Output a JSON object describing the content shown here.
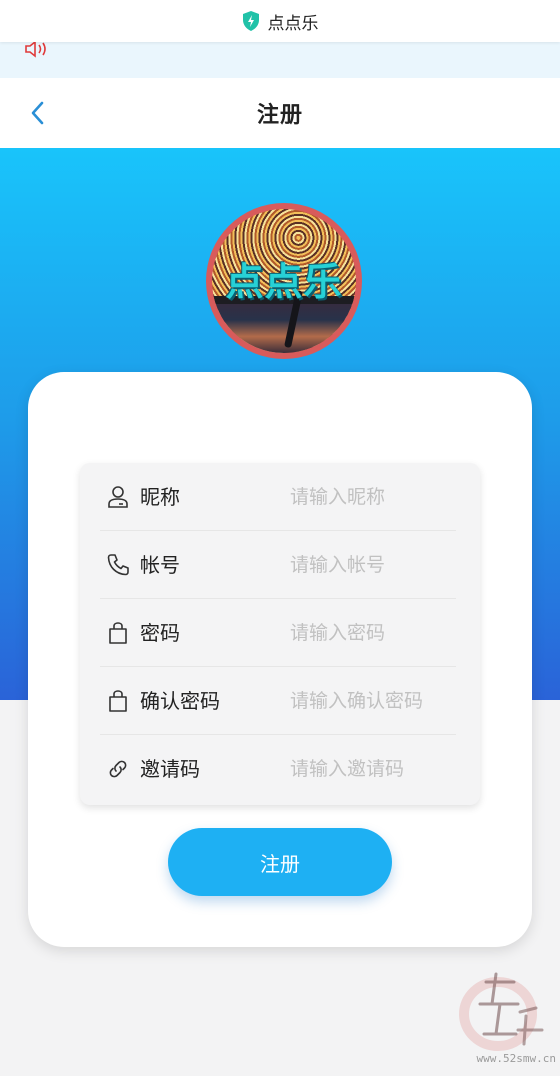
{
  "topbar": {
    "title": "点点乐",
    "icon": "shield-bolt-icon",
    "accent": "#21c2a8"
  },
  "notice": {
    "icon": "speaker-icon",
    "color": "#e03b3b"
  },
  "header": {
    "title": "注册",
    "back_icon": "chevron-left-icon"
  },
  "logo": {
    "text": "点点乐"
  },
  "form": {
    "fields": [
      {
        "label": "昵称",
        "placeholder": "请输入昵称",
        "value": "",
        "icon": "user-icon"
      },
      {
        "label": "帐号",
        "placeholder": "请输入帐号",
        "value": "",
        "icon": "phone-icon"
      },
      {
        "label": "密码",
        "placeholder": "请输入密码",
        "value": "",
        "icon": "bag-icon"
      },
      {
        "label": "确认密码",
        "placeholder": "请输入确认密码",
        "value": "",
        "icon": "bag-icon"
      },
      {
        "label": "邀请码",
        "placeholder": "请输入邀请码",
        "value": "",
        "icon": "link-icon"
      }
    ],
    "submit_label": "注册"
  },
  "colors": {
    "gradient_top": "#19c4fb",
    "gradient_bottom": "#2a63d8",
    "button": "#1eb0f3"
  },
  "watermark": {
    "site": "www.52smw.cn"
  }
}
